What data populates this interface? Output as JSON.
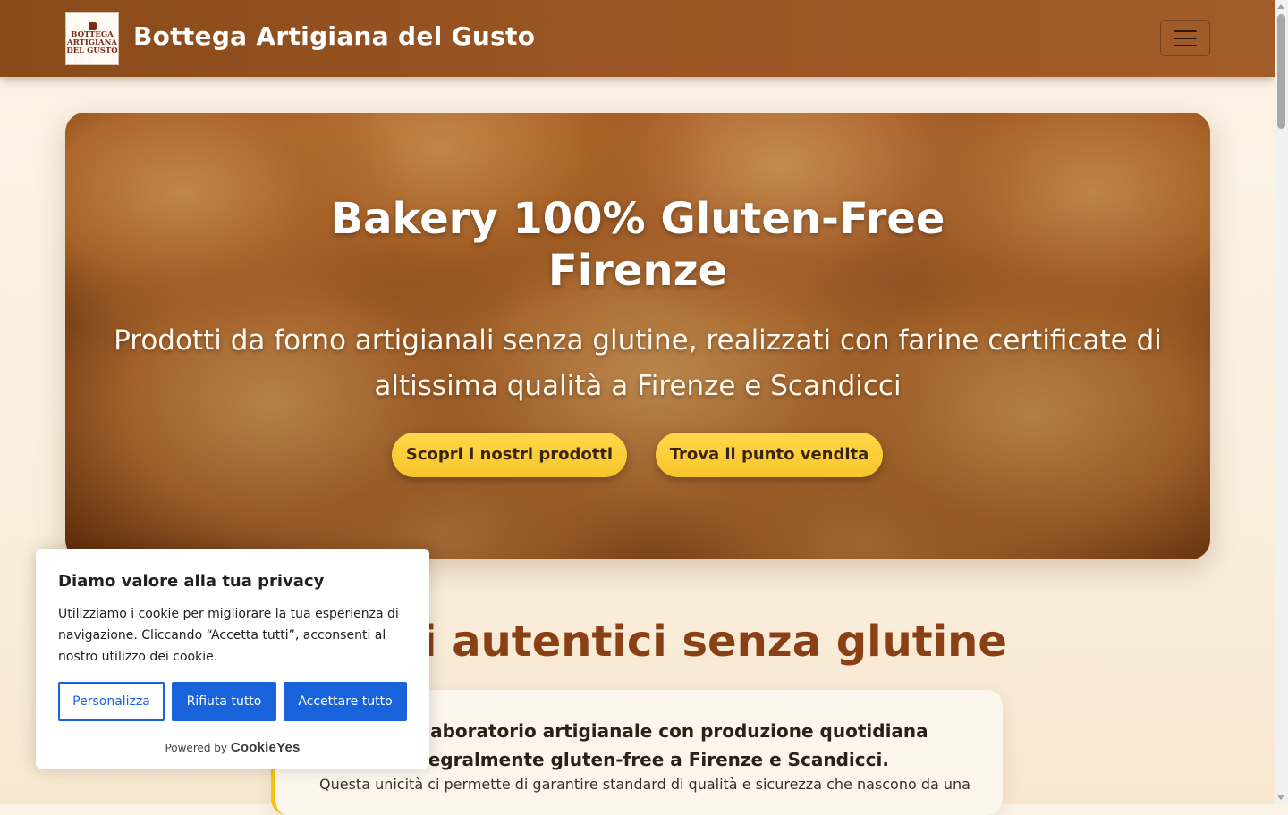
{
  "header": {
    "logo_lines": [
      "BOTTEGA",
      "ARTIGIANA",
      "DEL GUSTO"
    ],
    "brand": "Bottega Artigiana del Gusto",
    "menu_icon": "hamburger-icon"
  },
  "hero": {
    "title": "Bakery 100% Gluten-Free Firenze",
    "subtitle": "Prodotti da forno artigianali senza glutine, realizzati con farine certificate di altissima qualità a Firenze e Scandicci",
    "buttons": {
      "products": "Scopri i nostri prodotti",
      "store": "Trova il punto vendita"
    }
  },
  "section": {
    "title": "Sapori autentici senza glutine",
    "card_strong": "Unico laboratorio artigianale con produzione quotidiana integralmente gluten-free a Firenze e Scandicci.",
    "card_text": "Questa unicità ci permette di garantire standard di qualità e sicurezza che nascono da una"
  },
  "cookie_banner": {
    "title": "Diamo valore alla tua privacy",
    "text": "Utilizziamo i cookie per migliorare la tua esperienza di navigazione. Cliccando “Accetta tutti”, acconsenti al nostro utilizzo dei cookie.",
    "customize": "Personalizza",
    "reject": "Rifiuta tutto",
    "accept": "Accettare tutto",
    "powered_by": "Powered by",
    "provider": "CookieYes"
  },
  "colors": {
    "navbar": "#9b5524",
    "accent_yellow": "#f7c52a",
    "section_title": "#8a4015",
    "cookie_blue": "#1863dc"
  }
}
